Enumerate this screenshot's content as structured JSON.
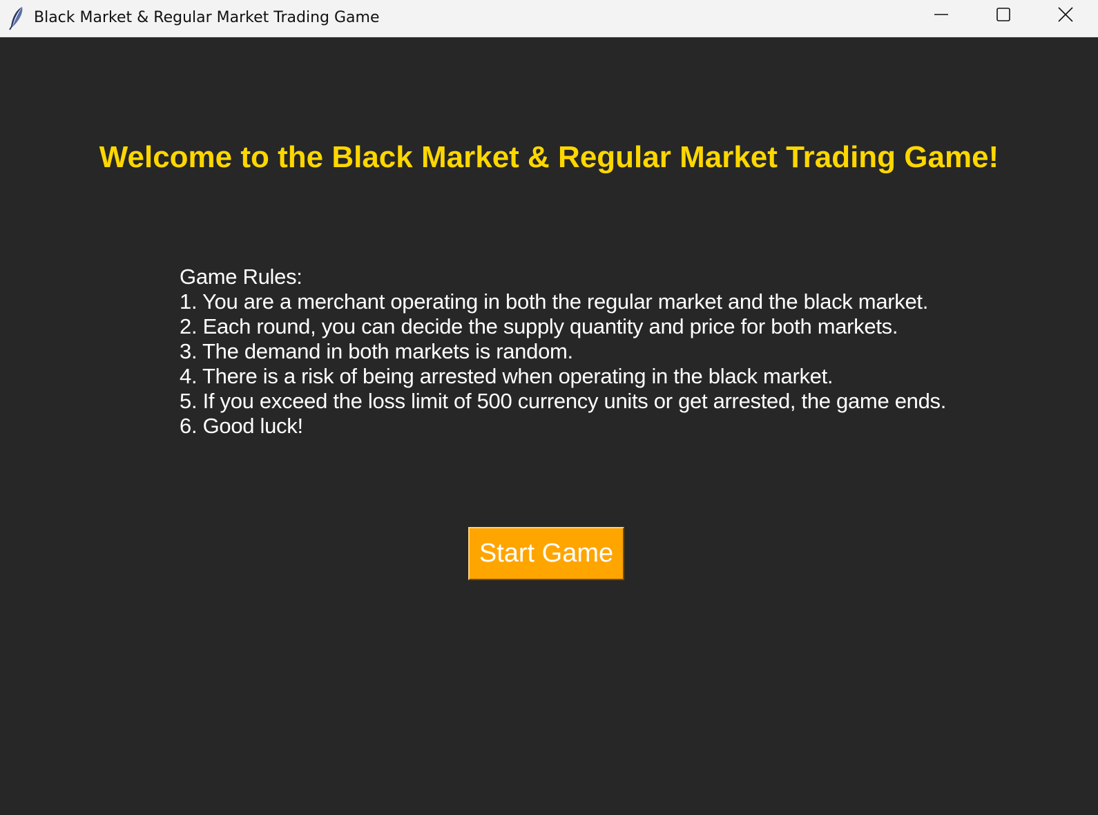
{
  "window": {
    "title": "Black Market & Regular Market Trading Game",
    "icon": "feather-icon",
    "controls": [
      "minimize-icon",
      "maximize-icon",
      "close-icon"
    ]
  },
  "main": {
    "welcome": "Welcome to the Black Market & Regular Market Trading Game!",
    "rules": [
      "Game Rules:",
      "1. You are a merchant operating in both the regular market and the black market.",
      "2. Each round, you can decide the supply quantity and price for both markets.",
      "3. The demand in both markets is random.",
      "4. There is a risk of being arrested when operating in the black market.",
      "5. If you exceed the loss limit of 500 currency units or get arrested, the game ends.",
      "6. Good luck!"
    ],
    "start_button": "Start Game"
  },
  "colors": {
    "background": "#272727",
    "title": "#ffd700",
    "button": "#ffa500",
    "text": "#ffffff"
  }
}
